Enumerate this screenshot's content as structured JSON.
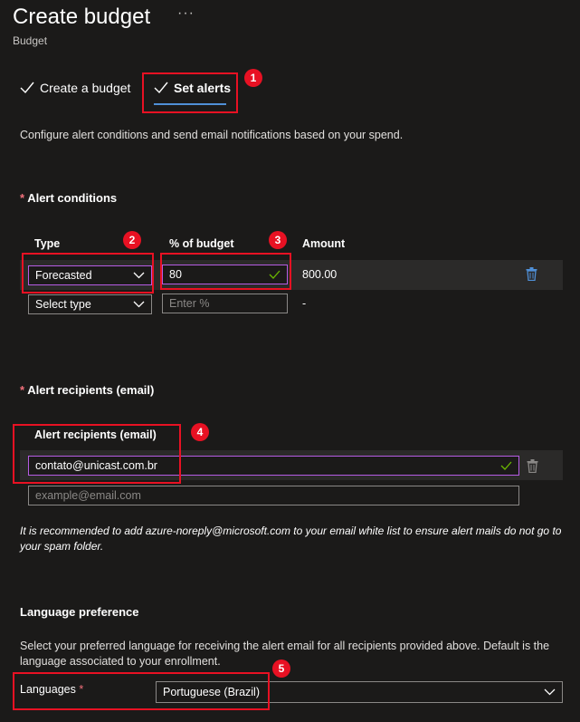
{
  "header": {
    "title": "Create budget",
    "more_label": "···",
    "subtitle": "Budget"
  },
  "steps": [
    {
      "label": "Create a budget",
      "state": "completed"
    },
    {
      "label": "Set alerts",
      "state": "current"
    }
  ],
  "description": "Configure alert conditions and send email notifications based on your spend.",
  "alert_conditions": {
    "title": "Alert conditions",
    "required_marker": "*",
    "columns": {
      "type": "Type",
      "percent": "% of budget",
      "amount": "Amount"
    },
    "rows": [
      {
        "type": "Forecasted",
        "percent": "80",
        "amount": "800.00"
      }
    ],
    "new_row": {
      "type_placeholder": "Select type",
      "percent_placeholder": "Enter %",
      "amount": "-"
    }
  },
  "alert_recipients": {
    "title": "Alert recipients (email)",
    "required_marker": "*",
    "column_header": "Alert recipients (email)",
    "emails": [
      "contato@unicast.com.br"
    ],
    "new_email_placeholder": "example@email.com",
    "note": "It is recommended to add azure-noreply@microsoft.com to your email white list to ensure alert mails do not go to your spam folder."
  },
  "language": {
    "title": "Language preference",
    "description": "Select your preferred language for receiving the alert email for all recipients provided above. Default is the language associated to your enrollment.",
    "label": "Languages",
    "required_marker": "*",
    "selected": "Portuguese (Brazil)"
  },
  "annotations": [
    "1",
    "2",
    "3",
    "4",
    "5"
  ],
  "colors": {
    "background": "#1b1a19",
    "callout": "#e81123",
    "focus_border": "#b65ce4",
    "accent": "#4f8fd6",
    "required": "#f1707b",
    "valid_check": "#6bb700"
  }
}
